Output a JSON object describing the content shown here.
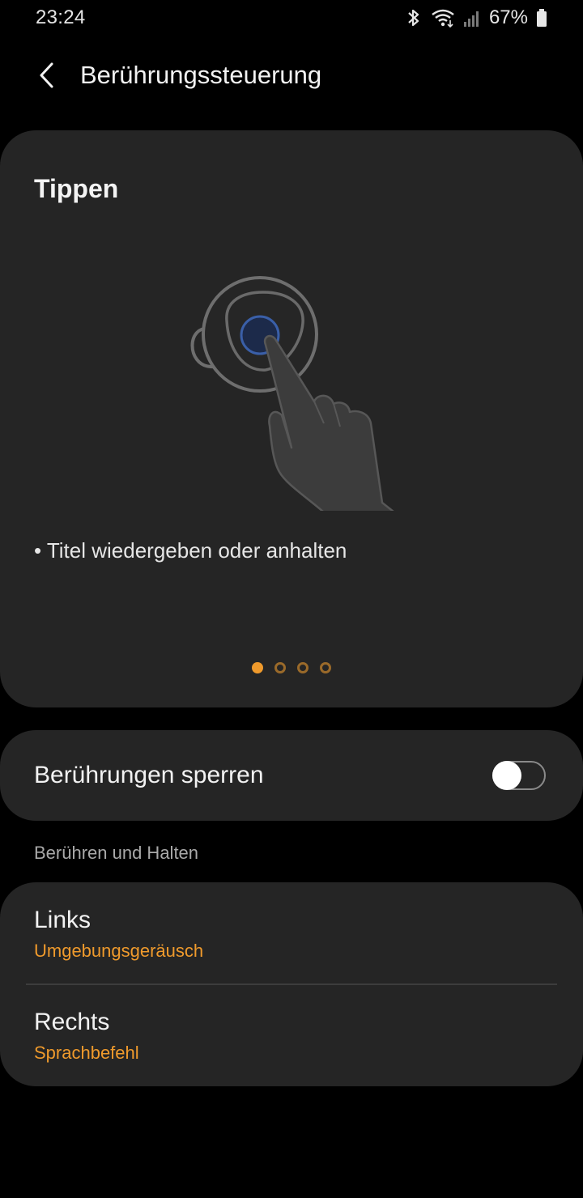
{
  "status_bar": {
    "time": "23:24",
    "battery": "67%",
    "icons": [
      "bluetooth-icon",
      "wifi-icon",
      "signal-icon",
      "battery-icon"
    ]
  },
  "header": {
    "title": "Berührungssteuerung",
    "back_icon": "back-arrow-icon"
  },
  "gesture_card": {
    "title": "Tippen",
    "illustration": "earbud-tap-illustration",
    "description": "• Titel wiedergeben oder anhalten",
    "pager": {
      "count": 4,
      "active_index": 0
    }
  },
  "lock_touch": {
    "label": "Berührungen sperren",
    "enabled": false
  },
  "touch_and_hold": {
    "section_label": "Berühren und Halten",
    "items": [
      {
        "title": "Links",
        "value": "Umgebungsgeräusch"
      },
      {
        "title": "Rechts",
        "value": "Sprachbefehl"
      }
    ]
  },
  "colors": {
    "background": "#000000",
    "card": "#252525",
    "accent": "#ef9a2c"
  }
}
